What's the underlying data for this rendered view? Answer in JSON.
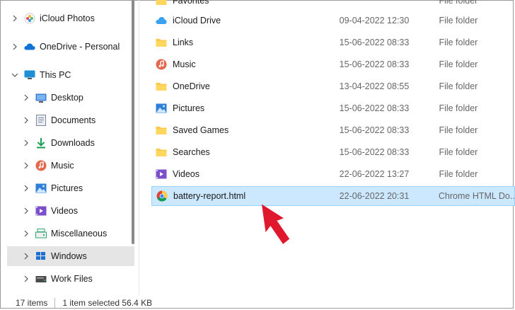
{
  "nav": {
    "items": [
      {
        "label": "iCloud Photos",
        "icon": "icloud-photos-icon",
        "chevron": "right"
      },
      {
        "label": "OneDrive - Personal",
        "icon": "onedrive-icon",
        "chevron": "right"
      },
      {
        "label": "This PC",
        "icon": "this-pc-icon",
        "chevron": "down"
      },
      {
        "label": "Desktop",
        "icon": "desktop-icon",
        "chevron": "right"
      },
      {
        "label": "Documents",
        "icon": "documents-icon",
        "chevron": "right"
      },
      {
        "label": "Downloads",
        "icon": "downloads-icon",
        "chevron": "right"
      },
      {
        "label": "Music",
        "icon": "music-icon",
        "chevron": "right"
      },
      {
        "label": "Pictures",
        "icon": "pictures-icon",
        "chevron": "right"
      },
      {
        "label": "Videos",
        "icon": "videos-icon",
        "chevron": "right"
      },
      {
        "label": "Miscellaneous",
        "icon": "drive-icon",
        "chevron": "right"
      },
      {
        "label": "Windows",
        "icon": "windows-drive-icon",
        "chevron": "right",
        "selected": true
      },
      {
        "label": "Work Files",
        "icon": "work-drive-icon",
        "chevron": "right"
      }
    ]
  },
  "files": [
    {
      "name": "Favorites",
      "date": "",
      "type": "File folder",
      "icon": "folder-icon"
    },
    {
      "name": "iCloud Drive",
      "date": "09-04-2022 12:30",
      "type": "File folder",
      "icon": "icloud-drive-icon"
    },
    {
      "name": "Links",
      "date": "15-06-2022 08:33",
      "type": "File folder",
      "icon": "folder-icon"
    },
    {
      "name": "Music",
      "date": "15-06-2022 08:33",
      "type": "File folder",
      "icon": "music-icon"
    },
    {
      "name": "OneDrive",
      "date": "13-04-2022 08:55",
      "type": "File folder",
      "icon": "folder-icon"
    },
    {
      "name": "Pictures",
      "date": "15-06-2022 08:33",
      "type": "File folder",
      "icon": "pictures-icon"
    },
    {
      "name": "Saved Games",
      "date": "15-06-2022 08:33",
      "type": "File folder",
      "icon": "folder-icon"
    },
    {
      "name": "Searches",
      "date": "15-06-2022 08:33",
      "type": "File folder",
      "icon": "folder-icon"
    },
    {
      "name": "Videos",
      "date": "22-06-2022 13:27",
      "type": "File folder",
      "icon": "videos-icon"
    },
    {
      "name": "battery-report.html",
      "date": "22-06-2022 20:31",
      "type": "Chrome HTML Do...",
      "icon": "chrome-icon",
      "selected": true
    }
  ],
  "status": {
    "item_count": "17 items",
    "selection": "1 item selected  56.4 KB"
  },
  "colors": {
    "selection_bg": "#cce8ff",
    "selection_border": "#99d1ff",
    "nav_selected": "#e5e5e5",
    "arrow": "#e0182d",
    "folder": "#f8c94a"
  }
}
